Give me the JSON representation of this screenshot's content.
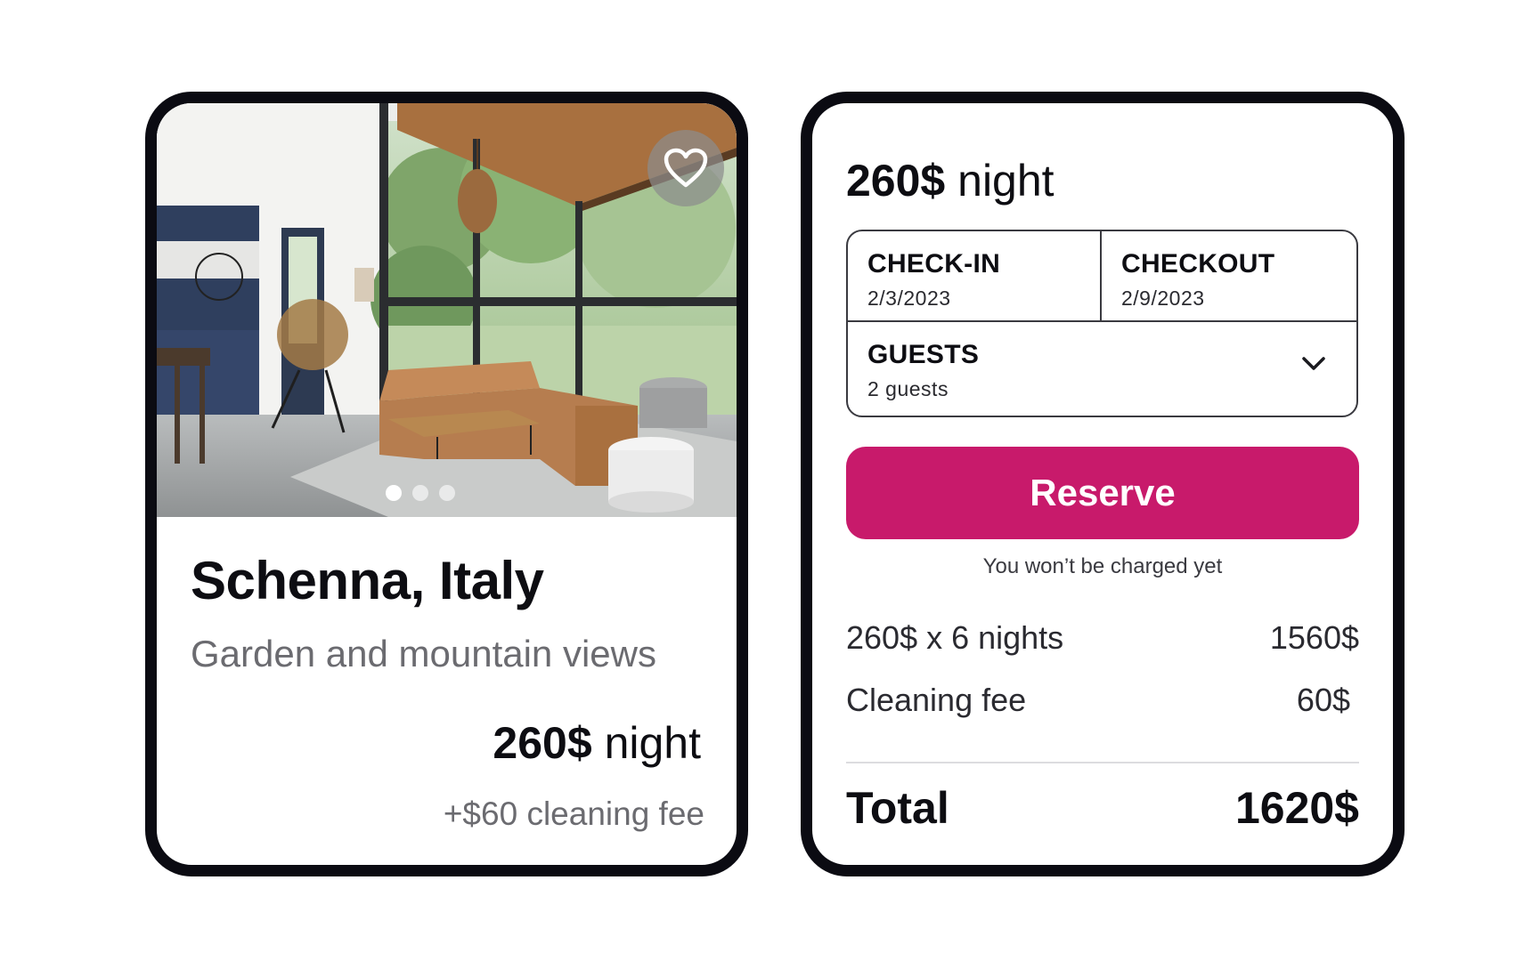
{
  "listing": {
    "title": "Schenna, Italy",
    "subtitle": "Garden and mountain views",
    "price_amount": "260$",
    "price_unit": "night",
    "cleaning_fee": "+$60 cleaning fee",
    "photo_dots": 3,
    "active_dot": 1,
    "favorite_icon": "heart-icon"
  },
  "booking": {
    "price_amount": "260$",
    "price_unit": "night",
    "checkin_label": "CHECK-IN",
    "checkin_value": "2/3/2023",
    "checkout_label": "CHECKOUT",
    "checkout_value": "2/9/2023",
    "guests_label": "GUESTS",
    "guests_value": "2 guests",
    "guests_icon": "chevron-down-icon",
    "reserve_label": "Reserve",
    "note": "You won’t be charged yet",
    "nights_line": "260$ x 6 nights",
    "nights_amount": "1560$",
    "cleaning_label": "Cleaning fee",
    "cleaning_amount": "60$",
    "total_label": "Total",
    "total_amount": "1620$"
  },
  "colors": {
    "accent": "#c81a6b",
    "border": "#0b0b12",
    "muted_text": "#6b6b70"
  }
}
